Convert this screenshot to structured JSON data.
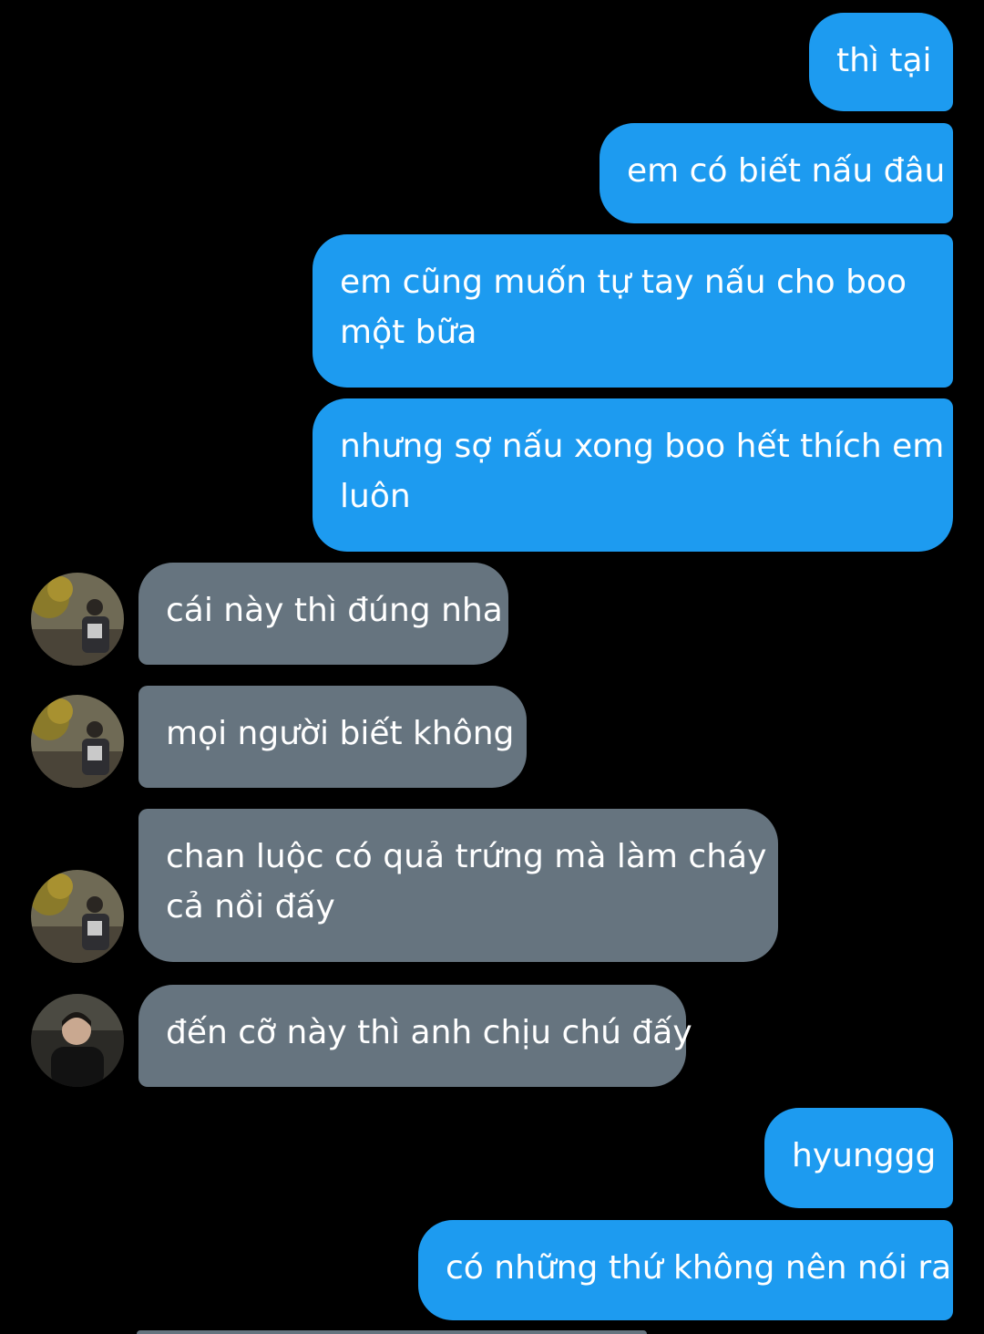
{
  "messages": [
    {
      "side": "sent",
      "text": "thì tại"
    },
    {
      "side": "sent",
      "text": "em có biết nấu đâu"
    },
    {
      "side": "sent",
      "line1": "em cũng muốn tự tay nấu cho boo",
      "line2": "một bữa"
    },
    {
      "side": "sent",
      "line1": "nhưng sợ nấu xong boo hết thích em",
      "line2": "luôn"
    },
    {
      "side": "received",
      "sender": "avatar-a",
      "text": "cái này thì đúng nha"
    },
    {
      "side": "received",
      "sender": "avatar-a",
      "text": "mọi người biết không"
    },
    {
      "side": "received",
      "sender": "avatar-a",
      "line1": "chan luộc có quả trứng mà làm cháy",
      "line2": "cả nồi đấy"
    },
    {
      "side": "received",
      "sender": "avatar-b",
      "text": "đến cỡ này thì anh chịu chú đấy"
    },
    {
      "side": "sent",
      "text": "hyunggg"
    },
    {
      "side": "sent",
      "text": "có những thứ không nên nói ra"
    }
  ],
  "colors": {
    "background": "#000000",
    "sent_bubble": "#1d9bf0",
    "received_bubble": "#66747f",
    "text": "#ffffff"
  }
}
